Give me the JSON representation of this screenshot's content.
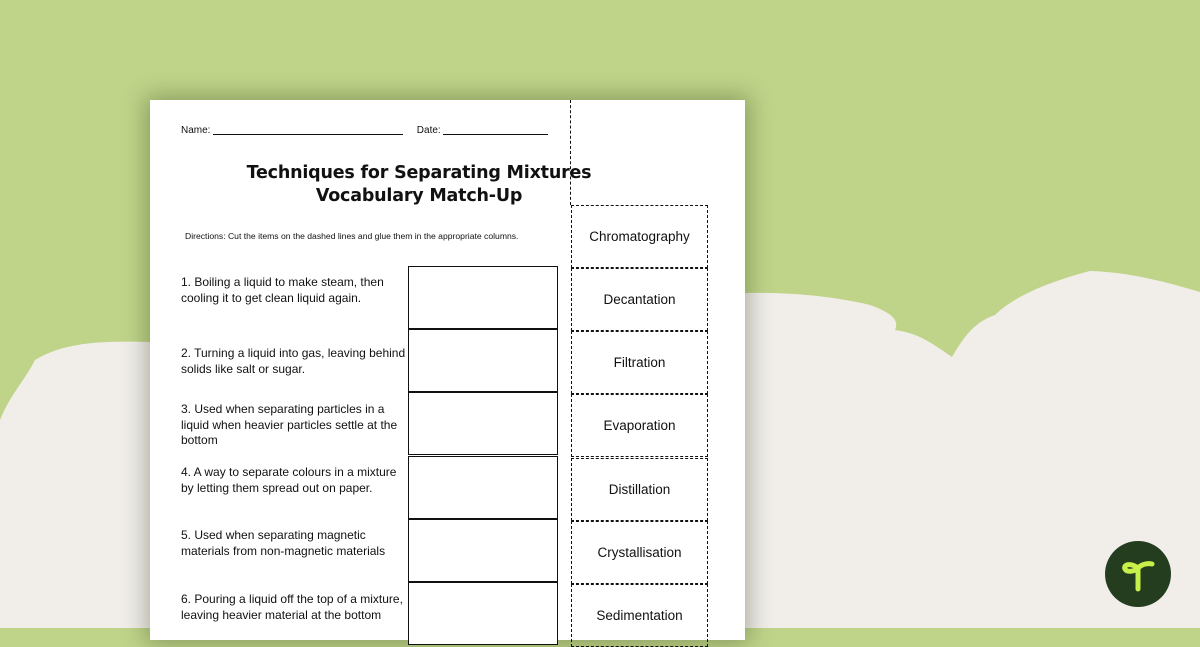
{
  "colors": {
    "background_green": "#bfd489",
    "background_cream": "#f1eeea",
    "logo_bg": "#243d1f",
    "logo_fg": "#c8f04a"
  },
  "worksheet": {
    "name_label": "Name:",
    "date_label": "Date:",
    "title_line1": "Techniques for Separating Mixtures",
    "title_line2": "Vocabulary Match-Up",
    "directions": "Directions: Cut the items on the dashed lines and glue them in the appropriate columns.",
    "questions": [
      {
        "text": "1.  Boiling a liquid to make steam, then cooling it to get clean liquid again."
      },
      {
        "text": "2.  Turning a liquid into gas, leaving behind solids like salt or sugar."
      },
      {
        "text": "3.  Used when separating particles in a liquid when heavier particles settle at the bottom"
      },
      {
        "text": "4.  A way to separate colours in a mixture by letting them spread out on paper."
      },
      {
        "text": "5.  Used when separating magnetic materials from non-magnetic materials"
      },
      {
        "text": "6. Pouring a liquid off the top of a mixture, leaving heavier material at the bottom"
      }
    ],
    "terms": [
      {
        "label": "Chromatography"
      },
      {
        "label": "Decantation"
      },
      {
        "label": "Filtration"
      },
      {
        "label": "Evaporation"
      },
      {
        "label": "Distillation"
      },
      {
        "label": "Crystallisation"
      },
      {
        "label": "Sedimentation"
      }
    ]
  },
  "logo": {
    "icon": "sprout-t-icon"
  }
}
